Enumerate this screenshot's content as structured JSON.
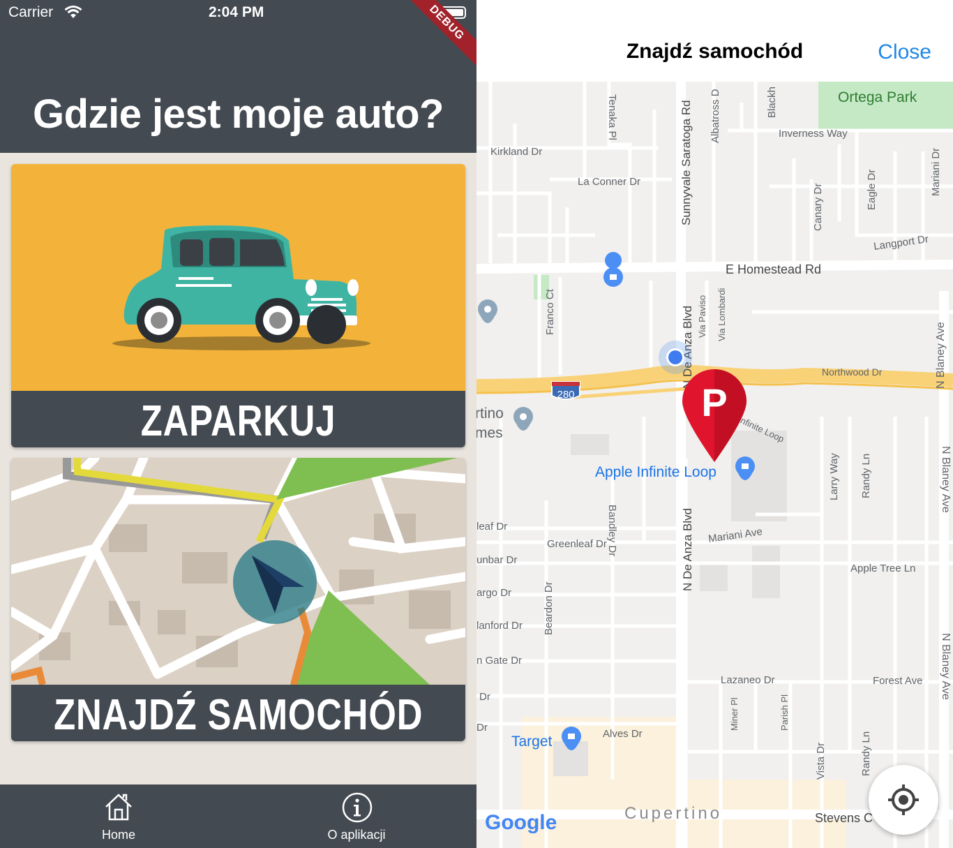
{
  "status": {
    "carrier": "Carrier",
    "time": "2:04 PM"
  },
  "debug_banner": "DEBUG",
  "app": {
    "title": "Gdzie jest moje auto?"
  },
  "cards": [
    {
      "label": "ZAPARKUJ SAMOCHÓD"
    },
    {
      "label": "ZNAJDŹ SAMOCHÓD"
    }
  ],
  "tabbar": {
    "items": [
      {
        "label": "Home",
        "icon": "home-icon"
      },
      {
        "label": "O aplikacji",
        "icon": "info-icon"
      }
    ]
  },
  "find_screen": {
    "title": "Znajdź samochód",
    "close_label": "Close"
  },
  "map": {
    "park_label": "Ortega Park",
    "highway_shield": "280",
    "poi_apple": "Apple Infinite Loop",
    "poi_target": "Target",
    "city_label": "Cupertino",
    "partial_place": [
      "rtino",
      "mes"
    ],
    "streets": {
      "tenaka": "Tenaka Pl",
      "saratoga": "Sunnyvale Saratoga Rd",
      "albatross": "Albatross D",
      "blackh": "Blackh",
      "kirkland": "Kirkland Dr",
      "inverness": "Inverness Way",
      "laconner": "La Conner Dr",
      "canary": "Canary Dr",
      "eagle": "Eagle Dr",
      "mariani_dr": "Mariani Dr",
      "langport": "Langport Dr",
      "homestead": "E Homestead Rd",
      "franco": "Franco Ct",
      "deanza_top": "N De Anza Blvd",
      "via_paviso": "Via Paviso",
      "via_lombardi": "Via Lombardi",
      "blaney_top": "N Blaney Ave",
      "northwood": "Northwood Dr",
      "infinite_loop": "Infinite Loop",
      "larry": "Larry Way",
      "randy_top": "Randy Ln",
      "blaney_mid": "N Blaney Ave",
      "greenleaf_left": "leaf Dr",
      "bandley": "Bandley Dr",
      "greenleaf": "Greenleaf Dr",
      "mariani_ave": "Mariani Ave",
      "deanza_mid": "N De Anza Blvd",
      "dunbar": "unbar Dr",
      "appletree": "Apple Tree Ln",
      "fargo": "argo Dr",
      "beardon": "Beardon Dr",
      "stanford": "lanford Dr",
      "gate": "n Gate Dr",
      "lazaneo": "Lazaneo Dr",
      "forest": "Forest Ave",
      "dr_a": "Dr",
      "miner": "Miner Pl",
      "parish": "Parish Pl",
      "vista": "Vista Dr",
      "randy_bottom": "Randy Ln",
      "dr_b": "Dr",
      "alves": "Alves Dr",
      "stevens": "Stevens C",
      "blaney_bottom": "N Blaney Ave"
    },
    "attribution": "Google",
    "parking_marker": "P"
  }
}
